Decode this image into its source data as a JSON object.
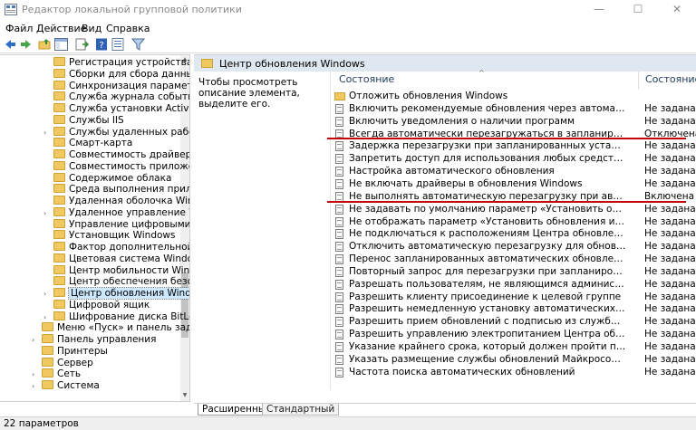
{
  "window": {
    "title": "Редактор локальной групповой политики",
    "minimize_glyph": "—",
    "maximize_glyph": "☐",
    "close_glyph": "✕"
  },
  "menu": {
    "file": "Файл",
    "action": "Действие",
    "view": "Вид",
    "help": "Справка"
  },
  "toolbar_icons": [
    "back-arrow-icon",
    "forward-arrow-icon",
    "up-folder-icon",
    "show-hide-tree-icon",
    "export-list-icon",
    "help-icon",
    "properties-icon",
    "filter-icon"
  ],
  "tree": {
    "items": [
      {
        "label": "Регистрация устройства",
        "expandable": false
      },
      {
        "label": "Сборки для сбора данных и п",
        "expandable": false
      },
      {
        "label": "Синхронизация параметров",
        "expandable": false
      },
      {
        "label": "Служба журнала событий",
        "expandable": false
      },
      {
        "label": "Служба установки ActiveX",
        "expandable": false
      },
      {
        "label": "Службы IIS",
        "expandable": false
      },
      {
        "label": "Службы удаленных рабочих с",
        "expandable": true
      },
      {
        "label": "Смарт-карта",
        "expandable": false
      },
      {
        "label": "Совместимость драйверов и у",
        "expandable": false
      },
      {
        "label": "Совместимость приложений",
        "expandable": false
      },
      {
        "label": "Содержимое облака",
        "expandable": false
      },
      {
        "label": "Среда выполнения приложен",
        "expandable": false
      },
      {
        "label": "Удаленная оболочка Windows",
        "expandable": false
      },
      {
        "label": "Удаленное управление Windov",
        "expandable": true
      },
      {
        "label": "Управление цифровыми прав",
        "expandable": false
      },
      {
        "label": "Установщик Windows",
        "expandable": false
      },
      {
        "label": "Фактор дополнительной прове",
        "expandable": false
      },
      {
        "label": "Цветовая система Windows Cc",
        "expandable": false
      },
      {
        "label": "Центр мобильности Windows",
        "expandable": false
      },
      {
        "label": "Центр обеспечения безопасно",
        "expandable": false
      },
      {
        "label": "Центр обновления Windows",
        "expandable": true,
        "selected": true
      },
      {
        "label": "Цифровой ящик",
        "expandable": false
      },
      {
        "label": "Шифрование диска BitLocker",
        "expandable": true
      }
    ],
    "top_items": [
      {
        "label": "Меню «Пуск» и панель задач"
      },
      {
        "label": "Панель управления",
        "expandable": true
      },
      {
        "label": "Принтеры"
      },
      {
        "label": "Сервер"
      },
      {
        "label": "Сеть",
        "expandable": true
      },
      {
        "label": "Система",
        "expandable": true
      }
    ]
  },
  "details": {
    "header_title": "Центр обновления Windows",
    "description": "Чтобы просмотреть описание элемента, выделите его.",
    "col_setting": "Состояние",
    "col_state": "Состояние",
    "rows": [
      {
        "name": "Отложить обновления Windows",
        "state": "",
        "folder": true
      },
      {
        "name": "Включить рекомендуемые обновления через автоматическое обновление",
        "state": "Не задана"
      },
      {
        "name": "Включить уведомления о наличии программ",
        "state": "Не задана"
      },
      {
        "name": "Всегда автоматически перезагружаться в запланированное время",
        "state": "Отключена"
      },
      {
        "name": "Задержка перезагрузки при запланированных установках",
        "state": "Не задана"
      },
      {
        "name": "Запретить доступ для использования любых средств Центра обновления ...",
        "state": "Не задана"
      },
      {
        "name": "Настройка автоматического обновления",
        "state": "Не задана"
      },
      {
        "name": "Не включать драйверы в обновления Windows",
        "state": "Не задана"
      },
      {
        "name": "Не выполнять автоматическую перезагрузку при автоматической установ...",
        "state": "Включена"
      },
      {
        "name": "Не задавать по умолчанию параметр «Установить обновления и завершит...",
        "state": "Не задана"
      },
      {
        "name": "Не отображать параметр «Установить обновления и завершить работу» в ...",
        "state": "Не задана"
      },
      {
        "name": "Не подключаться к расположениям Центра обновления Windows в Интер...",
        "state": "Не задана"
      },
      {
        "name": "Отключить автоматическую перезагрузку для обновлений во время перио...",
        "state": "Не задана"
      },
      {
        "name": "Перенос запланированных автоматических обновлений",
        "state": "Не задана"
      },
      {
        "name": "Повторный запрос для перезагрузки при запланированных установках",
        "state": "Не задана"
      },
      {
        "name": "Разрешать пользователям, не являющимся администраторами, получать ...",
        "state": "Не задана"
      },
      {
        "name": "Разрешить клиенту присоединение к целевой группе",
        "state": "Не задана"
      },
      {
        "name": "Разрешить немедленную установку автоматических обновлений",
        "state": "Не задана"
      },
      {
        "name": "Разрешить прием обновлений с подписью из службы обновлений Майкр...",
        "state": "Не задана"
      },
      {
        "name": "Разрешить управлению электропитанием Центра обновления Windows вы...",
        "state": "Не задана"
      },
      {
        "name": "Указание крайнего срока, который должен пройти перед автоматически...",
        "state": "Не задана"
      },
      {
        "name": "Указать размещение службы обновлений Майкрософт в интрасети",
        "state": "Не задана"
      },
      {
        "name": "Частота поиска автоматических обновлений",
        "state": "Не задана"
      }
    ]
  },
  "tabs": {
    "extended": "Расширенный",
    "standard": "Стандартный"
  },
  "status": {
    "text": "22 параметров"
  },
  "colors": {
    "highlight_line": "#c40000",
    "header_bg": "#dfe7f1",
    "selection_bg": "#cce8ff"
  }
}
